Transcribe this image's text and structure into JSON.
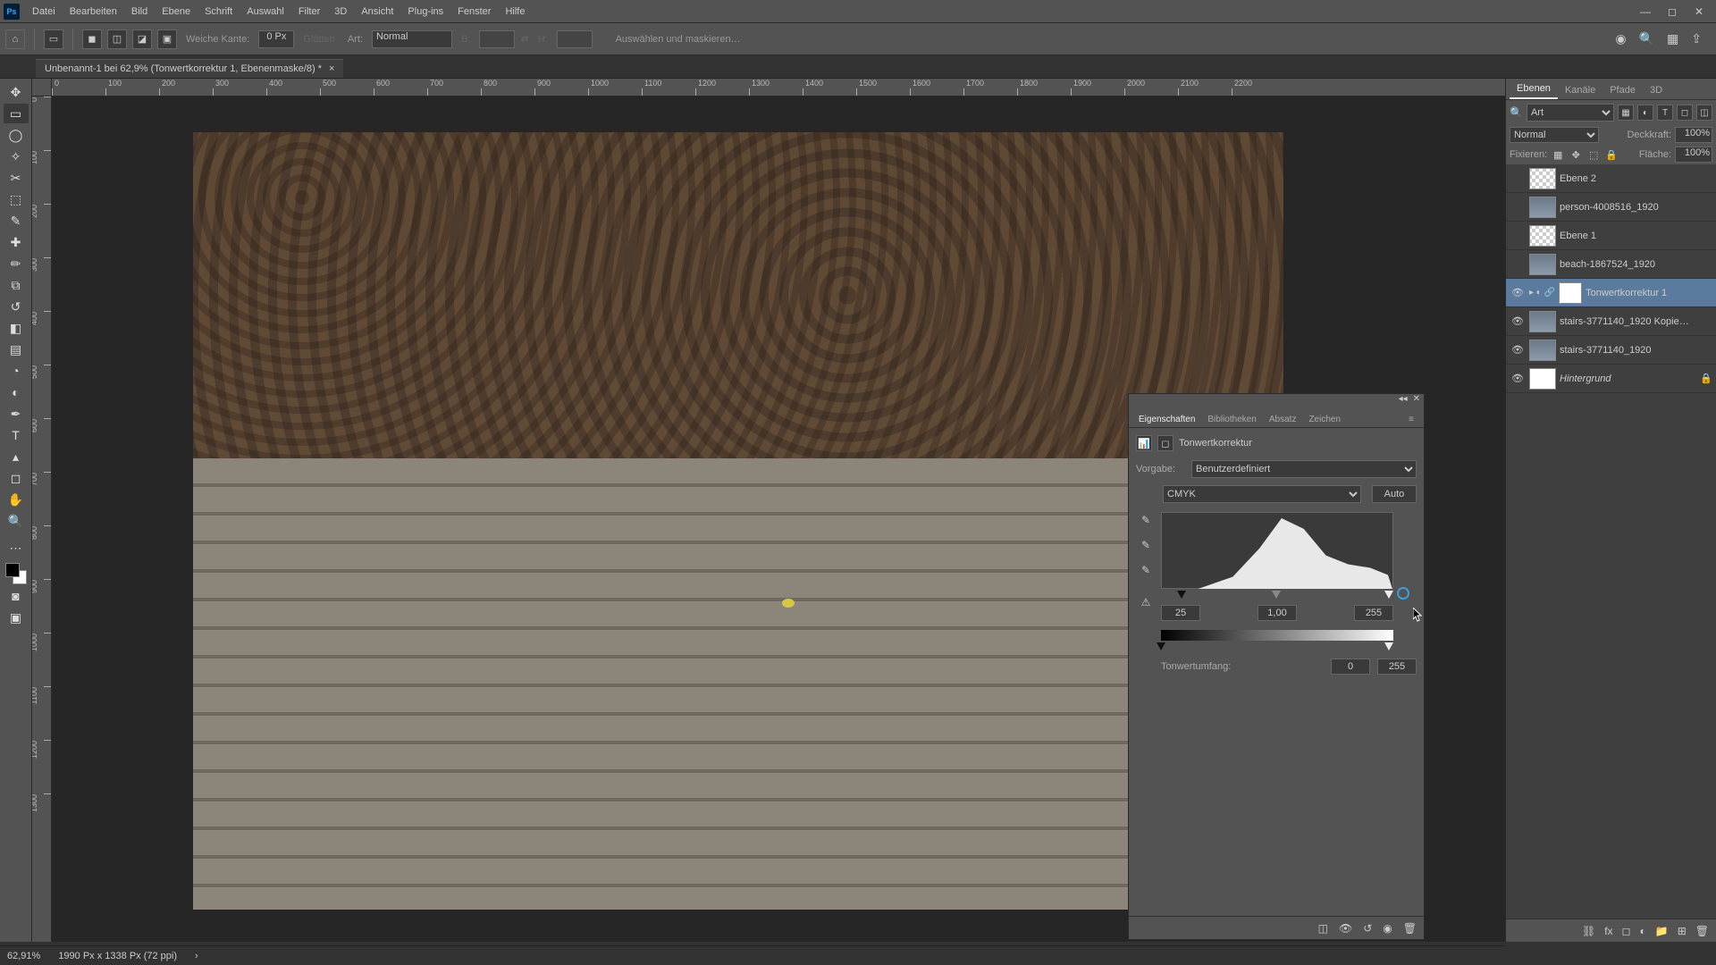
{
  "menu": {
    "items": [
      "Datei",
      "Bearbeiten",
      "Bild",
      "Ebene",
      "Schrift",
      "Auswahl",
      "Filter",
      "3D",
      "Ansicht",
      "Plug-ins",
      "Fenster",
      "Hilfe"
    ]
  },
  "options": {
    "feather_label": "Weiche Kante:",
    "feather_value": "0 Px",
    "smooth_label": "Glätten",
    "style_label": "Art:",
    "style_value": "Normal",
    "width_label": "B:",
    "height_label": "H:",
    "select_mask": "Auswählen und maskieren…"
  },
  "doc": {
    "title": "Unbenannt-1 bei 62,9% (Tonwertkorrektur 1, Ebenenmaske/8) *"
  },
  "ruler_h": [
    0,
    100,
    200,
    300,
    400,
    500,
    600,
    700,
    800,
    900,
    1000,
    1100,
    1200,
    1300,
    1400,
    1500,
    1600,
    1700,
    1800,
    1900,
    2000,
    2100,
    2200
  ],
  "ruler_v": [
    0,
    100,
    200,
    300,
    400,
    500,
    600,
    700,
    800,
    900,
    1000,
    1100,
    1200,
    1300
  ],
  "layers_panel": {
    "tabs": [
      "Ebenen",
      "Kanäle",
      "Pfade",
      "3D"
    ],
    "filter_kind": "Art",
    "blend_mode": "Normal",
    "opacity_label": "Deckkraft:",
    "opacity": "100%",
    "lock_label": "Fixieren:",
    "fill_label": "Fläche:",
    "fill": "100%",
    "layers": [
      {
        "visible": false,
        "name": "Ebene 2",
        "thumb": "checker"
      },
      {
        "visible": false,
        "name": "person-4008516_1920",
        "thumb": "img"
      },
      {
        "visible": false,
        "name": "Ebene 1",
        "thumb": "checker"
      },
      {
        "visible": false,
        "name": "beach-1867524_1920",
        "thumb": "img"
      },
      {
        "visible": true,
        "selected": true,
        "name": "Tonwertkorrektur 1",
        "adjustment": true
      },
      {
        "visible": true,
        "name": "stairs-3771140_1920 Kopie…",
        "thumb": "img"
      },
      {
        "visible": true,
        "name": "stairs-3771140_1920",
        "thumb": "img"
      },
      {
        "visible": true,
        "name": "Hintergrund",
        "thumb": "white",
        "locked": true
      }
    ]
  },
  "props": {
    "tabs": [
      "Eigenschaften",
      "Bibliotheken",
      "Absatz",
      "Zeichen"
    ],
    "adj_name": "Tonwertkorrektur",
    "preset_label": "Vorgabe:",
    "preset_value": "Benutzerdefiniert",
    "channel": "CMYK",
    "auto": "Auto",
    "black": "25",
    "gamma": "1,00",
    "white": "255",
    "output_label": "Tonwertumfang:",
    "out_black": "0",
    "out_white": "255"
  },
  "status": {
    "zoom": "62,91%",
    "doc_info": "1990 Px x 1338 Px (72 ppi)"
  }
}
